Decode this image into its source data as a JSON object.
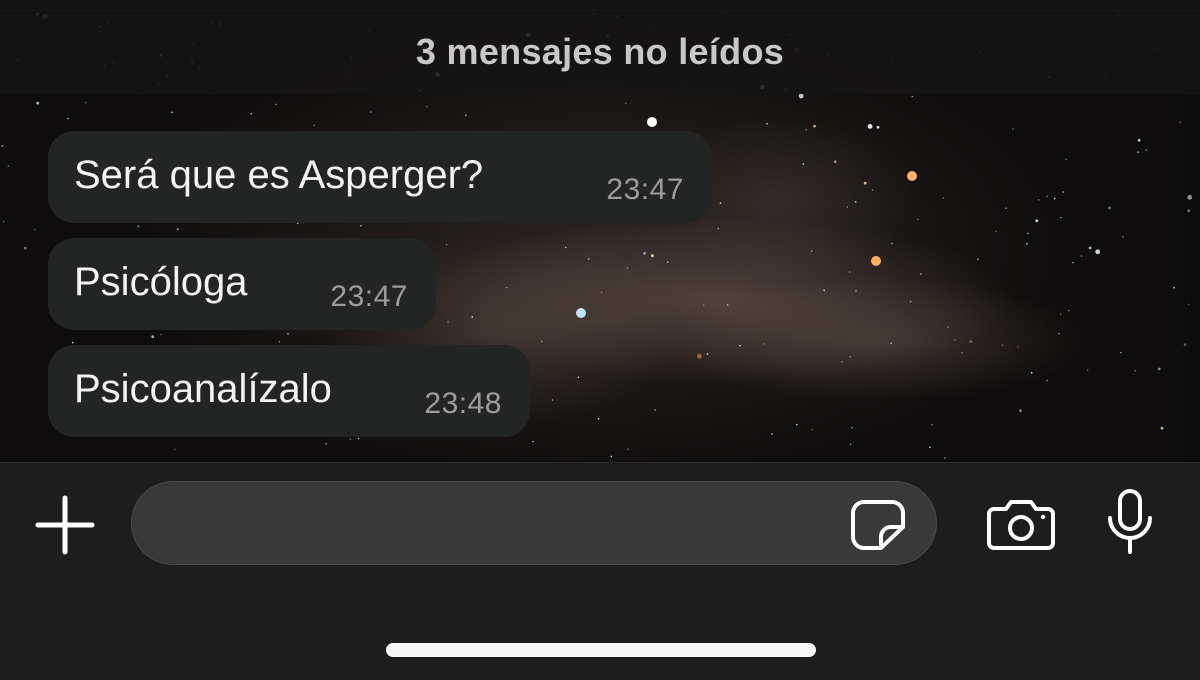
{
  "banner": {
    "unread_text": "3 mensajes no leídos"
  },
  "messages": [
    {
      "text": "Será que es Asperger?",
      "time": "23:47"
    },
    {
      "text": "Psicóloga",
      "time": "23:47"
    },
    {
      "text": "Psicoanalízalo",
      "time": "23:48"
    }
  ],
  "composer": {
    "value": "",
    "placeholder": "",
    "icons": {
      "add": "plus-icon",
      "sticker": "sticker-icon",
      "camera": "camera-icon",
      "mic": "microphone-icon"
    }
  },
  "colors": {
    "bubble": "#222524",
    "bar": "#1e1d1e",
    "input": "#3a3939",
    "banner_text": "#c9c7c8"
  }
}
